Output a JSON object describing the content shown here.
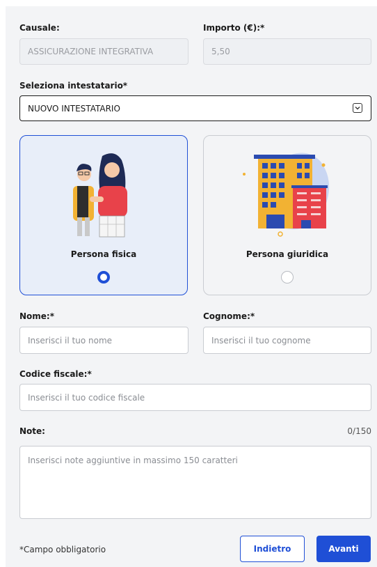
{
  "causale": {
    "label": "Causale:",
    "value": "ASSICURAZIONE INTEGRATIVA"
  },
  "importo": {
    "label": "Importo (€):*",
    "value": "5,50"
  },
  "intestatario": {
    "label": "Seleziona intestatario*",
    "value": "NUOVO INTESTATARIO"
  },
  "types": {
    "persona_fisica": {
      "label": "Persona fisica",
      "selected": true
    },
    "persona_giuridica": {
      "label": "Persona giuridica",
      "selected": false
    }
  },
  "nome": {
    "label": "Nome:*",
    "placeholder": "Inserisci il tuo nome"
  },
  "cognome": {
    "label": "Cognome:*",
    "placeholder": "Inserisci il tuo cognome"
  },
  "codice_fiscale": {
    "label": "Codice fiscale:*",
    "placeholder": "Inserisci il tuo codice fiscale"
  },
  "note": {
    "label": "Note:",
    "counter": "0/150",
    "placeholder": "Inserisci note aggiuntive in massimo 150 caratteri"
  },
  "footer": {
    "required_note": "*Campo obbligatorio",
    "back_label": "Indietro",
    "next_label": "Avanti"
  },
  "colors": {
    "primary": "#1f4fd6",
    "panel_bg": "#f3f4f6",
    "selected_card_bg": "#e8eef9"
  }
}
